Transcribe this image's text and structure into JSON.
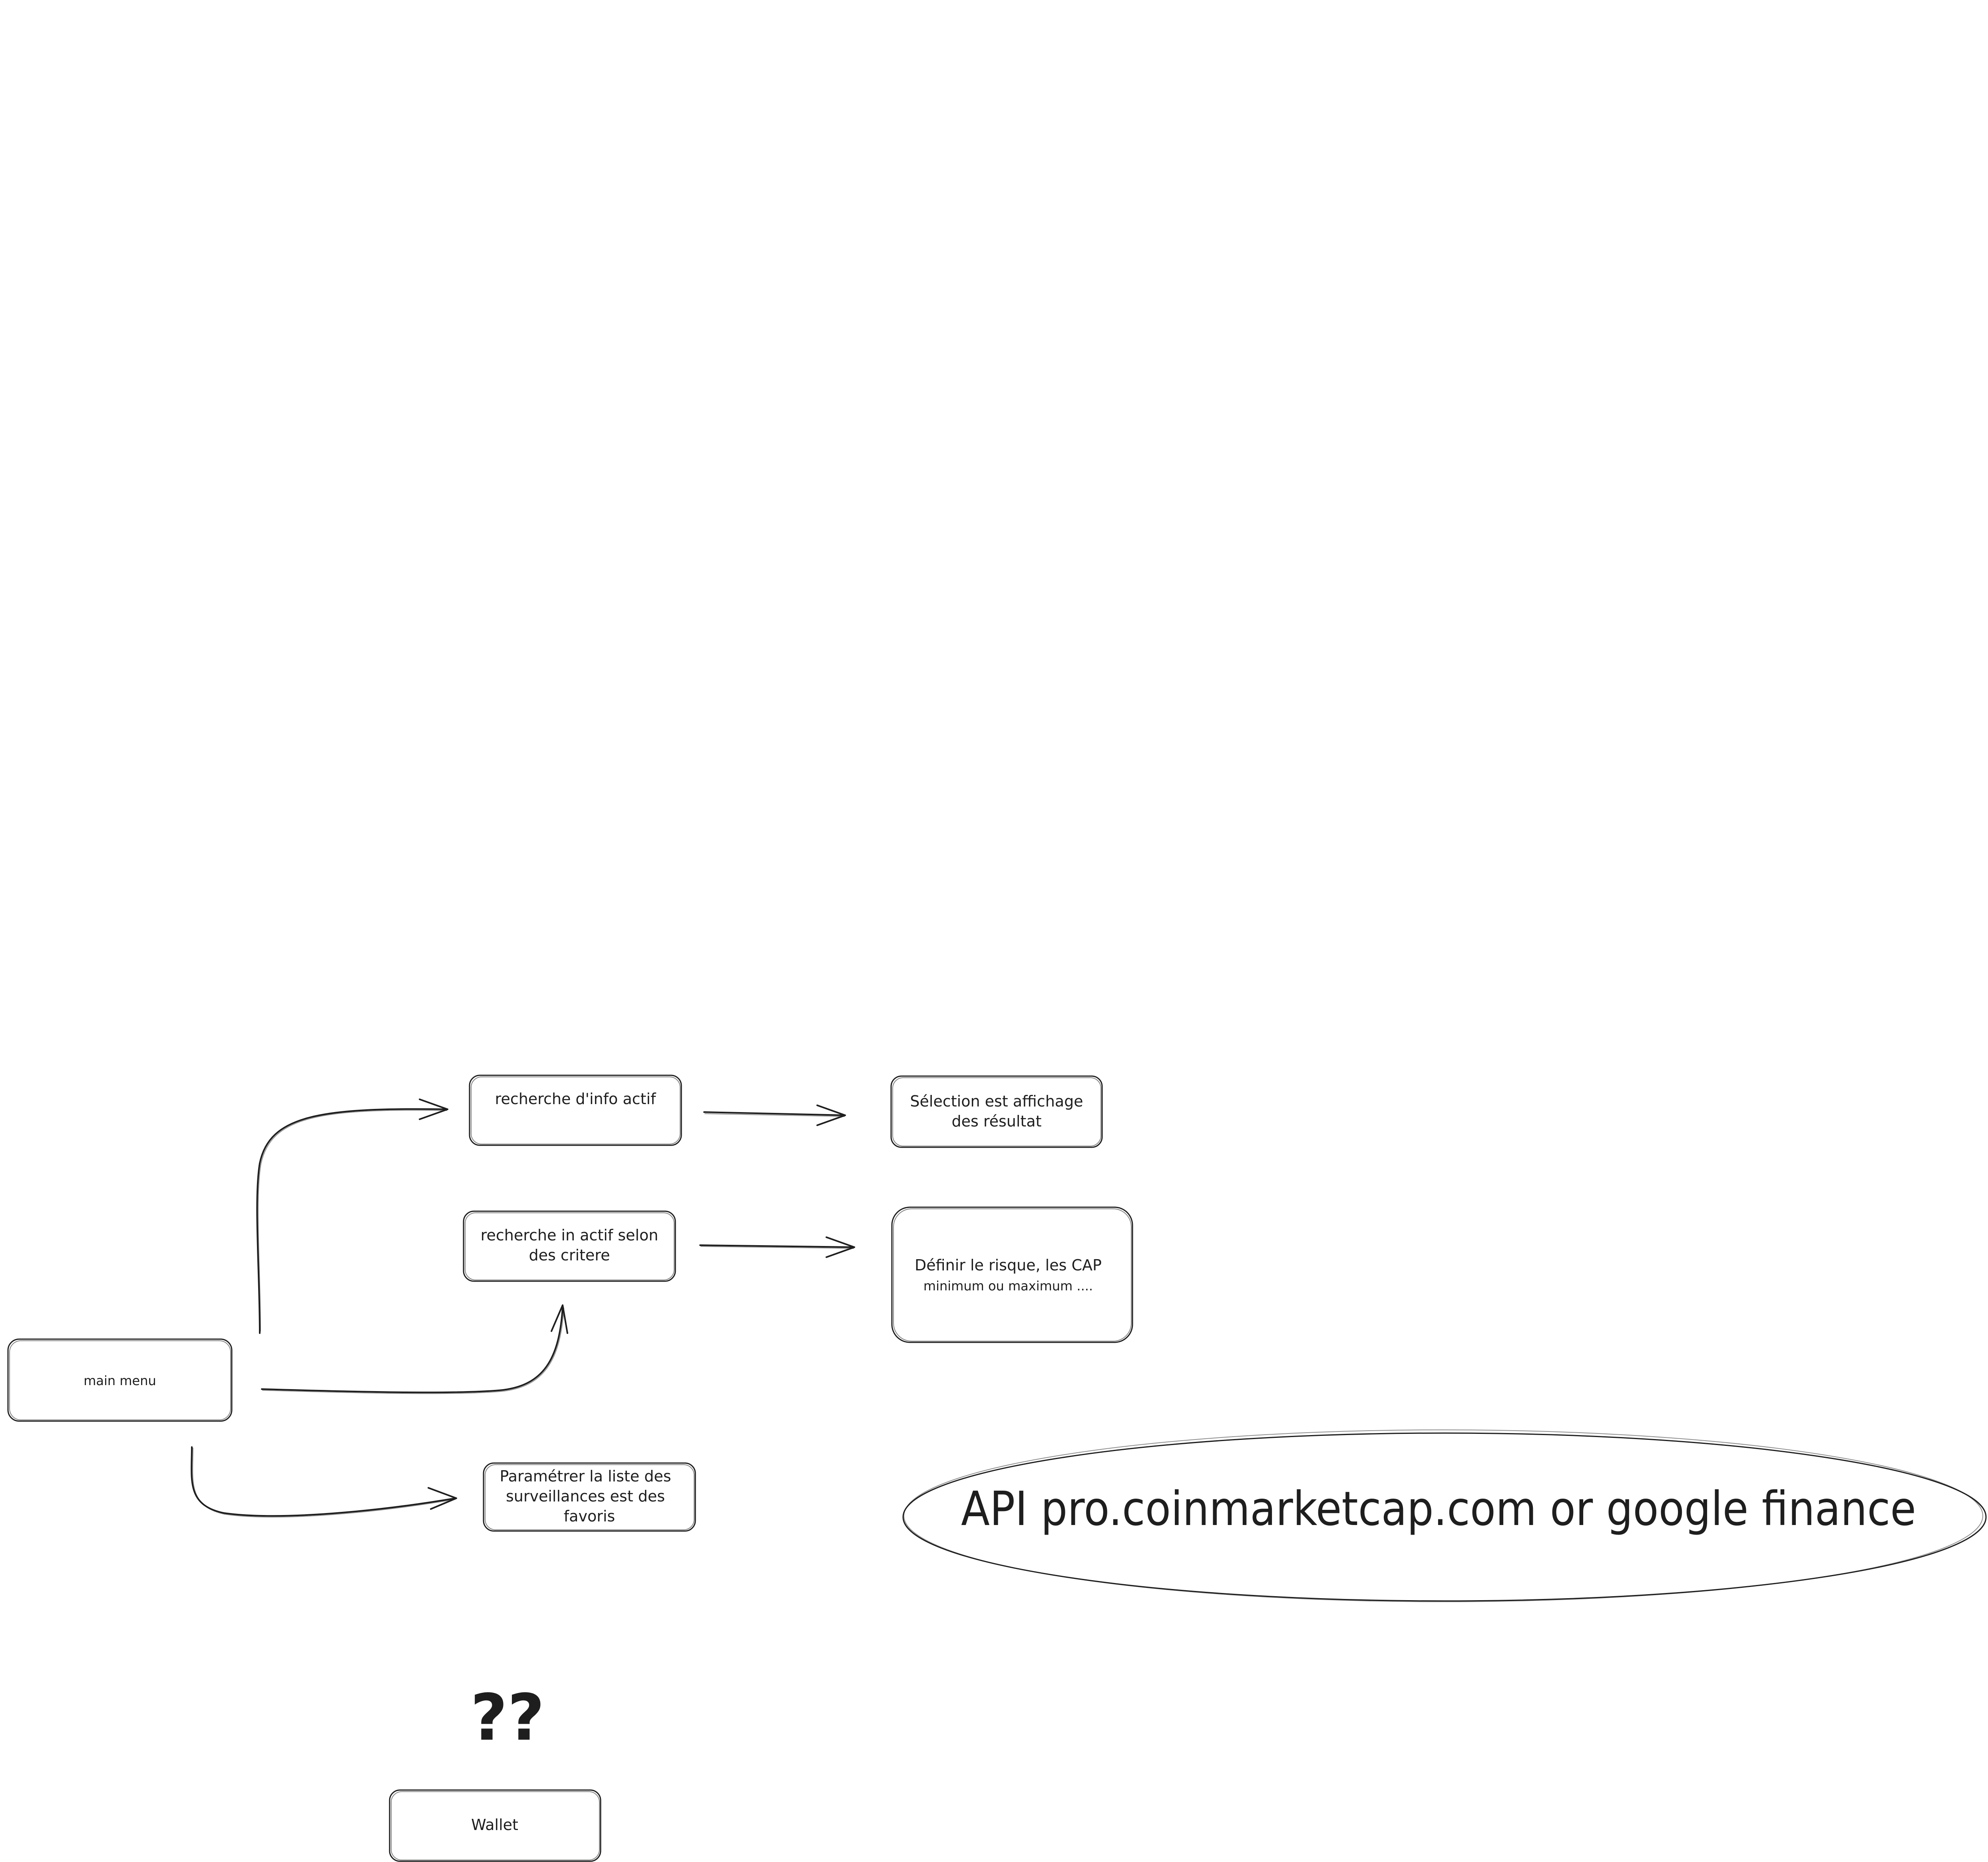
{
  "nodes": {
    "main_menu": {
      "label": "main menu"
    },
    "recherche_info": {
      "label": "recherche d'info actif"
    },
    "recherche_critere": {
      "lines": [
        "recherche in actif selon",
        "des critere"
      ]
    },
    "selection": {
      "lines": [
        "Sélection est affichage",
        "des résultat"
      ]
    },
    "definir": {
      "lines": [
        "Définir le risque, les CAP",
        "minimum ou maximum ...."
      ]
    },
    "parametrer": {
      "lines": [
        "Paramétrer la liste des",
        "surveillances est des",
        "favoris"
      ]
    },
    "wallet": {
      "label": "Wallet"
    }
  },
  "annotations": {
    "api": "API pro.coinmarketcap.com or google finance",
    "question": "??"
  },
  "edges": [
    {
      "from": "main_menu",
      "to": "recherche_info"
    },
    {
      "from": "main_menu",
      "to": "recherche_critere"
    },
    {
      "from": "main_menu",
      "to": "parametrer"
    },
    {
      "from": "recherche_info",
      "to": "selection"
    },
    {
      "from": "recherche_critere",
      "to": "definir"
    }
  ],
  "colors": {
    "stroke": "#1e1e1e",
    "background": "#ffffff"
  }
}
